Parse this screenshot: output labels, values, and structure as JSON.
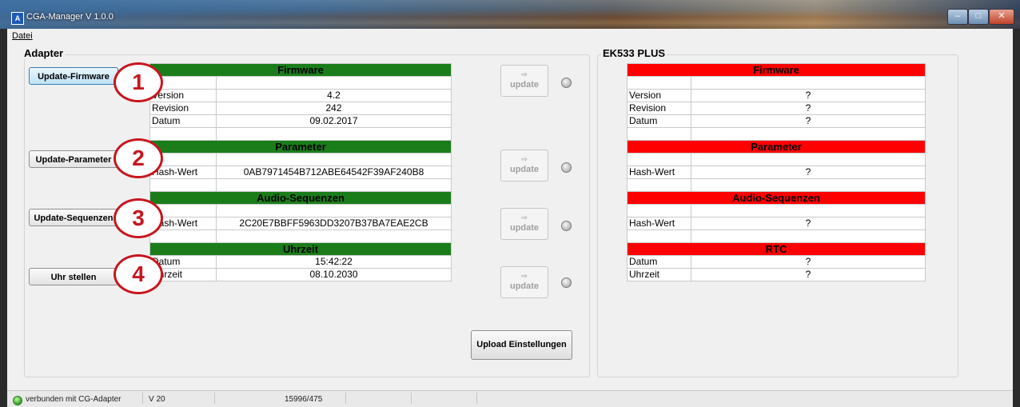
{
  "window": {
    "title": "CGA-Manager V 1.0.0",
    "minimize": "–",
    "maximize": "□",
    "close": "✕"
  },
  "menu": [
    "Datei"
  ],
  "adapter": {
    "title": "Adapter",
    "buttons": [
      "Update-Firmware",
      "Update-Parameter",
      "Update-Sequenzen",
      "Uhr stellen"
    ],
    "badges": [
      "1",
      "2",
      "3",
      "4"
    ],
    "firmware": {
      "header": "Firmware",
      "version_label": "Version",
      "version": "4.2",
      "revision_label": "Revision",
      "revision": "242",
      "datum_label": "Datum",
      "datum": "09.02.2017"
    },
    "parameter": {
      "header": "Parameter",
      "hash_label": "Hash-Wert",
      "hash": "0AB7971454B712ABE64542F39AF240B8"
    },
    "audio": {
      "header": "Audio-Sequenzen",
      "hash_label": "Hash-Wert",
      "hash": "2C20E7BBFF5963DD3207B37BA7EAE2CB"
    },
    "uhrzeit": {
      "header": "Uhrzeit",
      "datum_label": "Datum",
      "datum": "15:42:22",
      "uhrzeit_label": "Uhrzeit",
      "uhrzeit": "08.10.2030"
    },
    "header_color": "#1a7d1a"
  },
  "update_buttons": {
    "arrow": "⇨",
    "label": "update"
  },
  "upload_button": "Upload Einstellungen",
  "device": {
    "title": "EK533 PLUS",
    "firmware": {
      "header": "Firmware",
      "version_label": "Version",
      "version": "?",
      "revision_label": "Revision",
      "revision": "?",
      "datum_label": "Datum",
      "datum": "?"
    },
    "parameter": {
      "header": "Parameter",
      "hash_label": "Hash-Wert",
      "hash": "?"
    },
    "audio": {
      "header": "Audio-Sequenzen",
      "hash_label": "Hash-Wert",
      "hash": "?"
    },
    "rtc": {
      "header": "RTC",
      "datum_label": "Datum",
      "datum": "?",
      "uhrzeit_label": "Uhrzeit",
      "uhrzeit": "?"
    },
    "header_color": "#ff0000"
  },
  "status": {
    "connection": "verbunden mit CG-Adapter",
    "version": "V 20",
    "counter": "15996/475"
  }
}
